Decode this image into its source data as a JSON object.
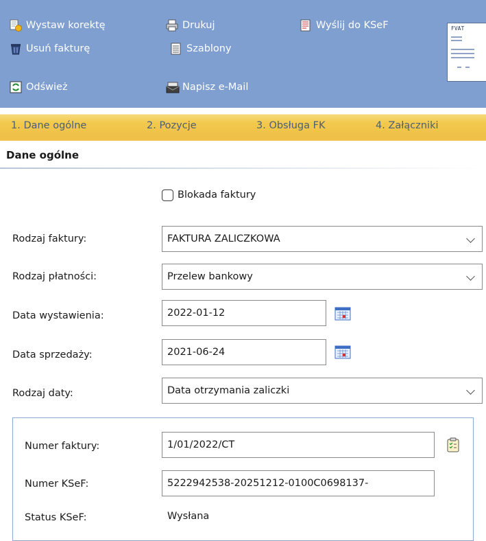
{
  "toolbar": {
    "issue_correction": "Wystaw korektę",
    "print": "Drukuj",
    "send_ksef": "Wyślij do KSeF",
    "delete_invoice": "Usuń fakturę",
    "templates": "Szablony",
    "refresh": "Odśwież",
    "write_email": "Napisz e-Mail",
    "preview_title": "FVAT"
  },
  "tabs": [
    {
      "label": "1. Dane ogólne"
    },
    {
      "label": "2. Pozycje"
    },
    {
      "label": "3. Obsługa FK"
    },
    {
      "label": "4. Załączniki"
    }
  ],
  "section": {
    "title": "Dane ogólne"
  },
  "form": {
    "lock_label": "Blokada faktury",
    "invoice_type_label": "Rodzaj faktury:",
    "invoice_type_value": "FAKTURA ZALICZKOWA",
    "payment_type_label": "Rodzaj płatności:",
    "payment_type_value": "Przelew bankowy",
    "issue_date_label": "Data wystawienia:",
    "issue_date_value": "2022-01-12",
    "sale_date_label": "Data sprzedaży:",
    "sale_date_value": "2021-06-24",
    "date_type_label": "Rodzaj daty:",
    "date_type_value": "Data otrzymania zaliczki",
    "invoice_number_label": "Numer faktury:",
    "invoice_number_value": "1/01/2022/CT",
    "ksef_number_label": "Numer KSeF:",
    "ksef_number_value": "5222942538-20251212-0100C0698137-",
    "ksef_status_label": "Status KSeF:",
    "ksef_status_value": "Wysłana"
  },
  "colors": {
    "toolbar_bg": "#7f9fd1",
    "tab_bar": "#f0c148",
    "group_border": "#8ea7cf"
  },
  "icons": [
    "correction-icon",
    "print-icon",
    "send-ksef-icon",
    "trash-icon",
    "templates-icon",
    "refresh-icon",
    "email-icon",
    "calendar-icon",
    "clipboard-icon",
    "invoice-preview"
  ]
}
